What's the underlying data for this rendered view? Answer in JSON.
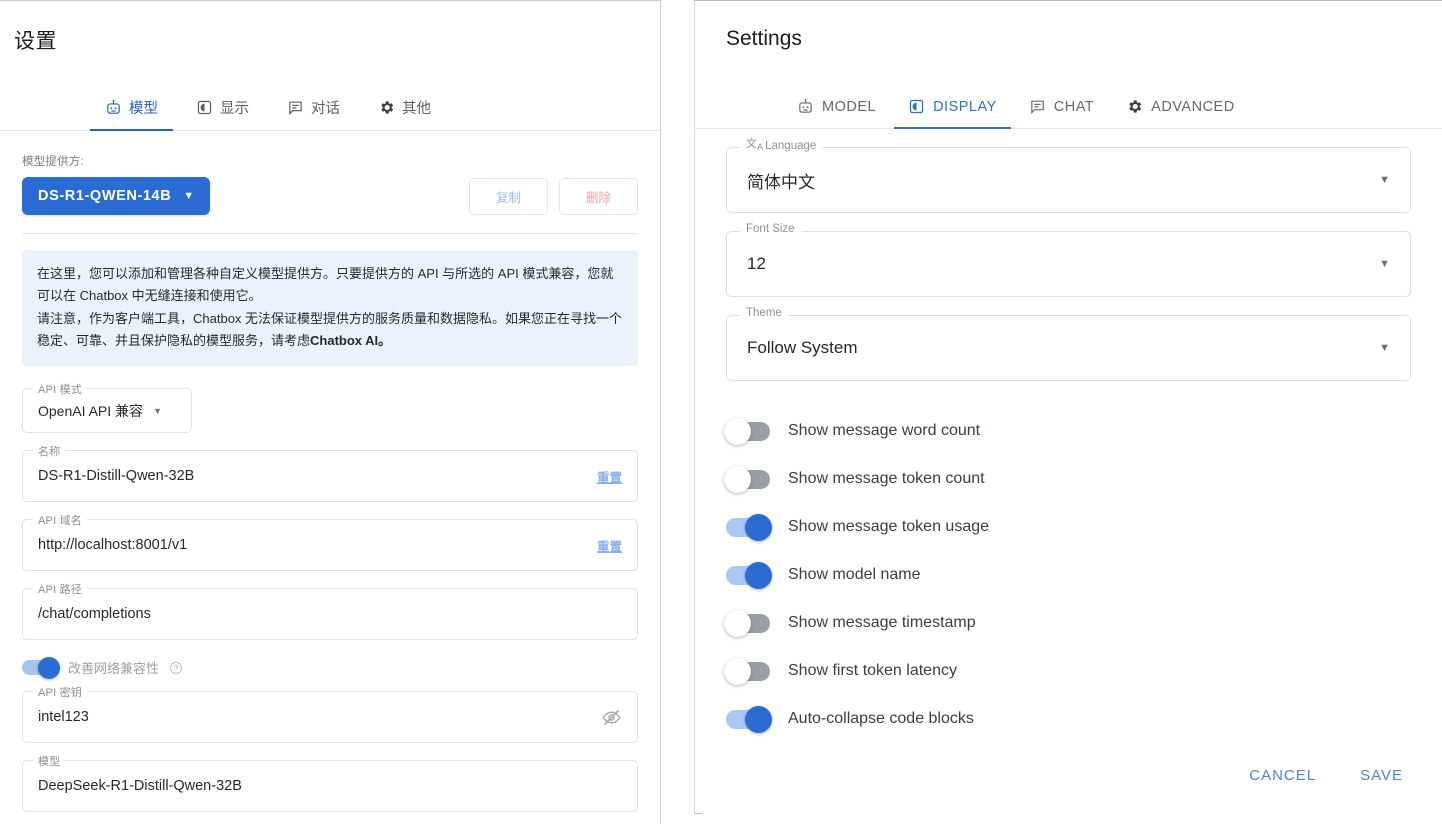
{
  "left": {
    "title": "设置",
    "tabs": [
      {
        "label": "模型",
        "icon": "robot-icon",
        "active": true
      },
      {
        "label": "显示",
        "icon": "display-icon",
        "active": false
      },
      {
        "label": "对话",
        "icon": "chat-icon",
        "active": false
      },
      {
        "label": "其他",
        "icon": "gear-icon",
        "active": false
      }
    ],
    "provider_label": "模型提供方:",
    "provider_value": "DS-R1-QWEN-14B",
    "copy_button": "复制",
    "delete_button": "删除",
    "info_lines": [
      "在这里，您可以添加和管理各种自定义模型提供方。只要提供方的 API 与所选的 API 模式兼容，您就可以在 Chatbox 中无缝连接和使用它。",
      "请注意，作为客户端工具，Chatbox 无法保证模型提供方的服务质量和数据隐私。如果您正在寻找一个稳定、可靠、并且保护隐私的模型服务，请考虑"
    ],
    "info_bold": "Chatbox AI。",
    "api_mode": {
      "legend": "API 模式",
      "value": "OpenAI API 兼容"
    },
    "name_field": {
      "legend": "名称",
      "value": "DS-R1-Distill-Qwen-32B",
      "reset": "重置"
    },
    "host_field": {
      "legend": "API 域名",
      "value": "http://localhost:8001/v1",
      "reset": "重置"
    },
    "path_field": {
      "legend": "API 路径",
      "value": "/chat/completions"
    },
    "compat_toggle": {
      "label": "改善网络兼容性",
      "on": true,
      "help": "?"
    },
    "key_field": {
      "legend": "API 密钥",
      "value": "intel123",
      "icon": "eye-off-icon"
    },
    "model_field": {
      "legend": "模型",
      "value": "DeepSeek-R1-Distill-Qwen-32B"
    }
  },
  "right": {
    "title": "Settings",
    "tabs": [
      {
        "label": "MODEL",
        "icon": "robot-icon",
        "active": false
      },
      {
        "label": "DISPLAY",
        "icon": "display-icon",
        "active": true
      },
      {
        "label": "CHAT",
        "icon": "chat-icon",
        "active": false
      },
      {
        "label": "ADVANCED",
        "icon": "gear-icon",
        "active": false
      }
    ],
    "language": {
      "legend": "Language",
      "value": "简体中文",
      "icon": "translate-icon"
    },
    "font_size": {
      "legend": "Font Size",
      "value": "12"
    },
    "theme": {
      "legend": "Theme",
      "value": "Follow System"
    },
    "toggles": [
      {
        "label": "Show message word count",
        "on": false
      },
      {
        "label": "Show message token count",
        "on": false
      },
      {
        "label": "Show message token usage",
        "on": true
      },
      {
        "label": "Show model name",
        "on": true
      },
      {
        "label": "Show message timestamp",
        "on": false
      },
      {
        "label": "Show first token latency",
        "on": false
      },
      {
        "label": "Auto-collapse code blocks",
        "on": true
      }
    ],
    "cancel_button": "CANCEL",
    "save_button": "SAVE"
  },
  "colors": {
    "accent_blue": "#2b6cd4",
    "tab_active": "#2563c9",
    "link_blue": "#4d82de",
    "delete_red": "#f0a2a2",
    "info_bg": "#eaf3fb",
    "toggle_off": "#9a9fa6"
  }
}
